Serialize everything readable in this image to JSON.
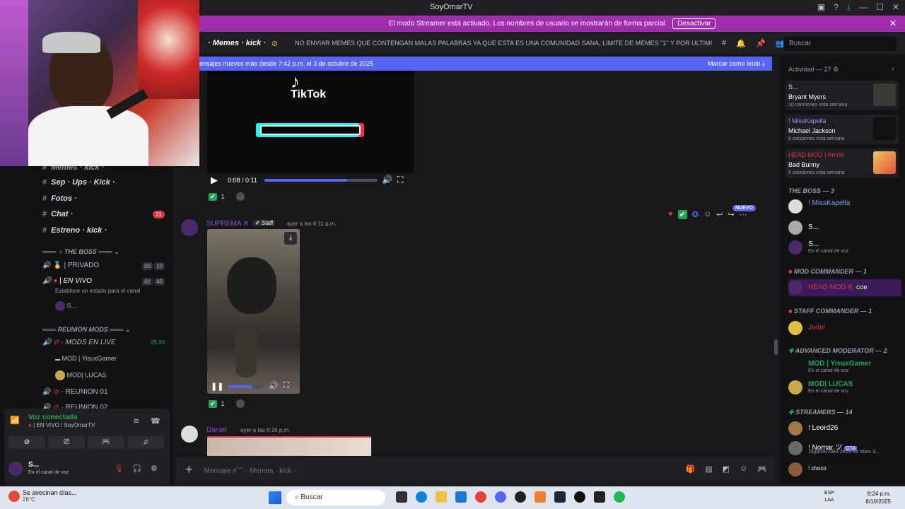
{
  "window": {
    "title": "SoyOmarTV"
  },
  "banner": {
    "text": "El modo Streamer está activado. Los nombres de usuario se mostrarán de forma parcial.",
    "button": "Desactivar"
  },
  "channel_header": {
    "name": "· Memes · kick ·",
    "topic": "NO ENVIAR MEMES QUE CONTENGAN MALAS PALABRAS YA QUE ESTA ES UNA COMUNIDAD SANA, LIMITE DE MEMES \"1\" Y POR ULTIMO EL ...",
    "search_placeholder": "Buscar"
  },
  "new_messages_bar": {
    "text": "ensajes nuevos más desde 7:42 p.m. el 3 de octubre de 2025",
    "mark_read": "Marcar como leído"
  },
  "video1": {
    "brand": "TikTok",
    "time": "0:08 / 0:11",
    "progress": 0.73,
    "reaction_count": "1"
  },
  "message1": {
    "author": "SUPREMA ✕",
    "tag": "Staff",
    "timestamp": "ayer a las 6:11 p.m.",
    "new_badge": "NUEVO",
    "video_progress": 0.7,
    "reaction_count": "1"
  },
  "message2": {
    "author": "Daniel",
    "timestamp": "ayer a las 6:16 p.m."
  },
  "sidebar": {
    "top_partial": "Memes · kick ·",
    "channels": [
      {
        "name": "Sep · Ups · Kick ·",
        "badge": ""
      },
      {
        "name": "Fotos ·",
        "badge": ""
      },
      {
        "name": "Chat ·",
        "badge": "21"
      },
      {
        "name": "Estreno · kick ·",
        "badge": ""
      }
    ],
    "category_boss": "THE BOSS",
    "voice_privado": "| PRIVADO",
    "privado_counts": [
      "00",
      "10"
    ],
    "voice_envivo": "| EN VIVO",
    "envivo_counts": [
      "01",
      "40"
    ],
    "envivo_status": "Establece un estado para el canal",
    "envivo_user": "S...",
    "category_reunion": "REUNION MODS",
    "voice_mods_live": "· MODS EN LIVE",
    "mods_live_time": "25:30",
    "mods_users": [
      "MOD | YisuxGamer",
      "MOD| LUCAS"
    ],
    "voice_reunion01": "· REUNION 01",
    "voice_reunion02": "· REUNION 02"
  },
  "voice_panel": {
    "status": "Voz conectada",
    "channel": "| EN VIVO / SoyOmarTV",
    "user": "S...",
    "user_status": "En el canal de voz"
  },
  "right_panel": {
    "activity_title": "Actividad — 27",
    "activities": [
      {
        "user": "S...",
        "song": "Bryant Myers",
        "count": "10 canciones esta semana"
      },
      {
        "user": "! MissKapella",
        "song": "Michael Jackson",
        "count": "8 canciones esta semana"
      },
      {
        "user": "HEAD MOD | Amnir",
        "song": "Bad Bunny",
        "count": "6 canciones esta semana"
      }
    ],
    "role_boss": "THE BOSS — 3",
    "boss_members": [
      {
        "name": "! MissKapella",
        "status": ""
      },
      {
        "name": "S...",
        "status": ""
      },
      {
        "name": "S...",
        "status": "En el canal de voz"
      }
    ],
    "role_mod_commander": "MOD COMMANDER — 1",
    "mod_commander_member": "HEAD MOD K",
    "mod_commander_tag": "COB",
    "role_staff": "STAFF COMMANDER — 1",
    "staff_member": "Jodel",
    "role_adv": "ADVANCED MODERATOR — 2",
    "adv_members": [
      {
        "name": "MOD | YisuxGamer",
        "status": "En el canal de voz"
      },
      {
        "name": "MOD| LUCAS",
        "status": "En el canal de voz"
      }
    ],
    "role_streamers": "STREAMERS — 14",
    "streamers": [
      {
        "name": "! Leord26",
        "status": ""
      },
      {
        "name": "! Nomar ツ",
        "status": "Jugando NBA 2K26 for Xbox S..."
      },
      {
        "name": "! choco",
        "status": ""
      }
    ],
    "streamer_tag": "GTA"
  },
  "input": {
    "placeholder": "Mensaje #︶ · Memes · kick ·"
  },
  "taskbar": {
    "weather_title": "Se avecinan días...",
    "weather_temp": "26°C",
    "search": "Buscar",
    "lang1": "ESP",
    "lang2": "LAA",
    "time": "8:24 p.m.",
    "date": "8/10/2025"
  },
  "colors": {
    "banner": "#a22cb0",
    "accent": "#5865f2",
    "mention": "#da373c",
    "green": "#23a559"
  }
}
